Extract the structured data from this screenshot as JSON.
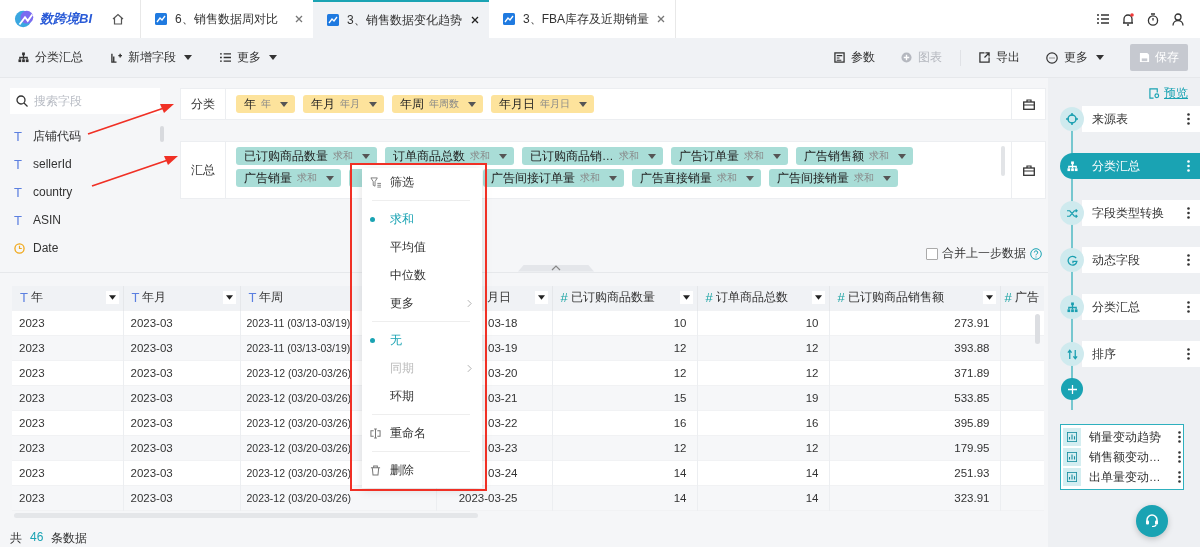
{
  "app": {
    "logo_text": "数跨境BI"
  },
  "tabs": [
    {
      "label": "6、销售数据周对比",
      "selected": false
    },
    {
      "label": "3、销售数据变化趋势",
      "selected": true
    },
    {
      "label": "3、FBA库存及近期销量",
      "selected": false
    }
  ],
  "toolbar": {
    "left": [
      {
        "label": "分类汇总",
        "dropdown": false
      },
      {
        "label": "新增字段",
        "dropdown": true
      },
      {
        "label": "更多",
        "dropdown": true
      }
    ],
    "right": [
      {
        "label": "参数",
        "disabled": false,
        "dropdown": false
      },
      {
        "label": "图表",
        "disabled": true,
        "dropdown": false
      },
      {
        "label": "导出",
        "disabled": false,
        "dropdown": false
      },
      {
        "label": "更多",
        "disabled": false,
        "dropdown": true
      }
    ],
    "save": {
      "label": "保存",
      "disabled": true
    }
  },
  "fields": {
    "placeholder": "搜索字段",
    "items": [
      {
        "name": "店铺代码",
        "kind": "text",
        "badge": "T"
      },
      {
        "name": "sellerId",
        "kind": "text",
        "badge": "T"
      },
      {
        "name": "country",
        "kind": "text",
        "badge": "T"
      },
      {
        "name": "ASIN",
        "kind": "text",
        "badge": "T"
      },
      {
        "name": "Date",
        "kind": "date"
      }
    ]
  },
  "group_by": {
    "label": "分类",
    "chips": [
      {
        "label": "年",
        "agg": "年"
      },
      {
        "label": "年月",
        "agg": "年月"
      },
      {
        "label": "年周",
        "agg": "年周数"
      },
      {
        "label": "年月日",
        "agg": "年月日"
      }
    ]
  },
  "summary": {
    "label": "汇总",
    "rows": [
      [
        {
          "kind": "chip",
          "label": "已订购商品数量",
          "agg": "求和"
        },
        {
          "kind": "chip",
          "label": "订单商品总数",
          "agg": "求和"
        },
        {
          "kind": "chip",
          "label": "已订购商品销…",
          "agg": "求和"
        },
        {
          "kind": "chip",
          "label": "广告订单量",
          "agg": "求和"
        },
        {
          "kind": "chip",
          "label": "广告销售额",
          "agg": "求和"
        }
      ],
      [
        {
          "kind": "chip",
          "label": "广告销量",
          "agg": "求和"
        },
        {
          "kind": "covered"
        },
        {
          "kind": "chip",
          "label": "广告间接订单量",
          "agg": "求和"
        },
        {
          "kind": "chip",
          "label": "广告直接销量",
          "agg": "求和"
        },
        {
          "kind": "chip",
          "label": "广告间接销量",
          "agg": "求和"
        }
      ]
    ]
  },
  "merge_option": {
    "label": "合并上一步数据",
    "checked": false
  },
  "context_menu": {
    "groups": [
      [
        {
          "label": "筛选",
          "selected": false,
          "disabled": false,
          "submenu": false
        }
      ],
      [
        {
          "label": "求和",
          "selected": true,
          "disabled": false,
          "submenu": false
        },
        {
          "label": "平均值",
          "selected": false,
          "disabled": false,
          "submenu": false
        },
        {
          "label": "中位数",
          "selected": false,
          "disabled": false,
          "submenu": false
        },
        {
          "label": "更多",
          "selected": false,
          "disabled": false,
          "submenu": true
        }
      ],
      [
        {
          "label": "无",
          "selected": true,
          "disabled": false,
          "submenu": false
        },
        {
          "label": "同期",
          "selected": false,
          "disabled": true,
          "submenu": true
        },
        {
          "label": "环期",
          "selected": false,
          "disabled": false,
          "submenu": false
        }
      ],
      [
        {
          "label": "重命名",
          "selected": false,
          "disabled": false,
          "submenu": false
        }
      ],
      [
        {
          "label": "删除",
          "selected": false,
          "disabled": false,
          "submenu": false
        }
      ]
    ]
  },
  "table": {
    "columns": [
      {
        "name": "年",
        "kind": "text",
        "badge": "T",
        "dropdown": true
      },
      {
        "name": "年月",
        "kind": "text",
        "badge": "T",
        "dropdown": true
      },
      {
        "name": "年周",
        "kind": "text",
        "badge": "T",
        "dropdown": false
      },
      {
        "name": "月日",
        "kind": "text",
        "dropdown": true
      },
      {
        "name": "已订购商品数量",
        "kind": "number",
        "badge": "#",
        "dropdown": true
      },
      {
        "name": "订单商品总数",
        "kind": "number",
        "badge": "#",
        "dropdown": true
      },
      {
        "name": "已订购商品销售额",
        "kind": "number",
        "badge": "#",
        "dropdown": true
      },
      {
        "name": "广告",
        "kind": "number",
        "badge": "#",
        "dropdown": false
      }
    ],
    "rows": [
      [
        "2023",
        "2023-03",
        "2023-11 (03/13-03/19)",
        "03-18",
        "10",
        "10",
        "273.91"
      ],
      [
        "2023",
        "2023-03",
        "2023-11 (03/13-03/19)",
        "03-19",
        "12",
        "12",
        "393.88"
      ],
      [
        "2023",
        "2023-03",
        "2023-12 (03/20-03/26)",
        "03-20",
        "12",
        "12",
        "371.89"
      ],
      [
        "2023",
        "2023-03",
        "2023-12 (03/20-03/26)",
        "03-21",
        "15",
        "19",
        "533.85"
      ],
      [
        "2023",
        "2023-03",
        "2023-12 (03/20-03/26)",
        "03-22",
        "16",
        "16",
        "395.89"
      ],
      [
        "2023",
        "2023-03",
        "2023-12 (03/20-03/26)",
        "03-23",
        "12",
        "12",
        "179.95"
      ],
      [
        "2023",
        "2023-03",
        "2023-12 (03/20-03/26)",
        "03-24",
        "14",
        "14",
        "251.93"
      ],
      [
        "2023",
        "2023-03",
        "2023-12 (03/20-03/26)",
        "2023-03-25",
        "14",
        "14",
        "323.91"
      ]
    ]
  },
  "footer": {
    "prefix": "共",
    "count": "46",
    "suffix": "条数据"
  },
  "pipeline": {
    "preview": "预览",
    "steps": [
      {
        "label": "来源表",
        "kind": "source",
        "selected": false
      },
      {
        "label": "分类汇总",
        "kind": "group",
        "selected": true
      },
      {
        "label": "字段类型转换",
        "kind": "convert",
        "selected": false
      },
      {
        "label": "动态字段",
        "kind": "dynamic",
        "selected": false
      },
      {
        "label": "分类汇总",
        "kind": "group",
        "selected": false
      },
      {
        "label": "排序",
        "kind": "sort",
        "selected": false
      }
    ],
    "outputs": [
      {
        "label": "销量变动趋势"
      },
      {
        "label": "销售额变动…"
      },
      {
        "label": "出单量变动…"
      }
    ]
  }
}
